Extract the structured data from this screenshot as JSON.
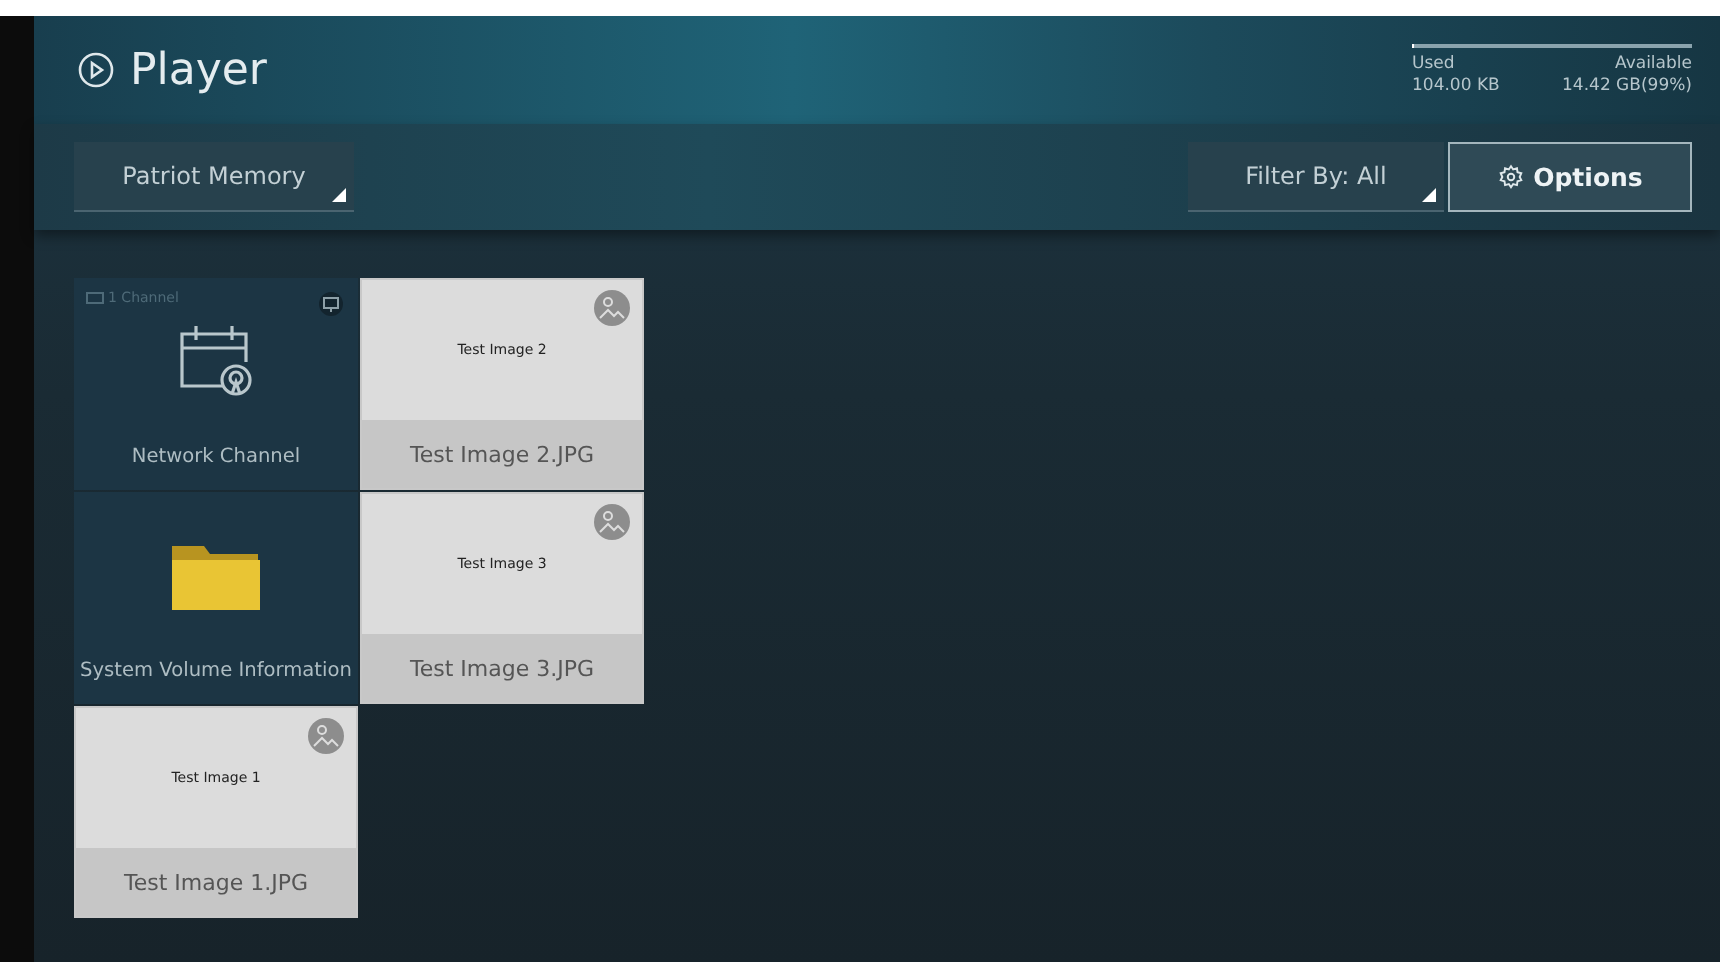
{
  "header": {
    "title": "Player"
  },
  "storage": {
    "level": 0.01,
    "used_label": "Used",
    "used_value": "104.00 KB",
    "available_label": "Available",
    "available_value": "14.42 GB(99%)"
  },
  "toolbar": {
    "source": "Patriot Memory",
    "filter": "Filter By: All",
    "options": "Options"
  },
  "tiles": [
    {
      "kind": "channel",
      "badge": "1 Channel",
      "caption": "Network Channel"
    },
    {
      "kind": "image",
      "thumb_text": "Test Image 2",
      "caption": "Test Image 2.JPG"
    },
    {
      "kind": "folder",
      "caption": "System Volume Information"
    },
    {
      "kind": "image",
      "thumb_text": "Test Image 3",
      "caption": "Test Image 3.JPG"
    },
    {
      "kind": "image",
      "thumb_text": "Test Image 1",
      "caption": "Test Image 1.JPG"
    }
  ]
}
